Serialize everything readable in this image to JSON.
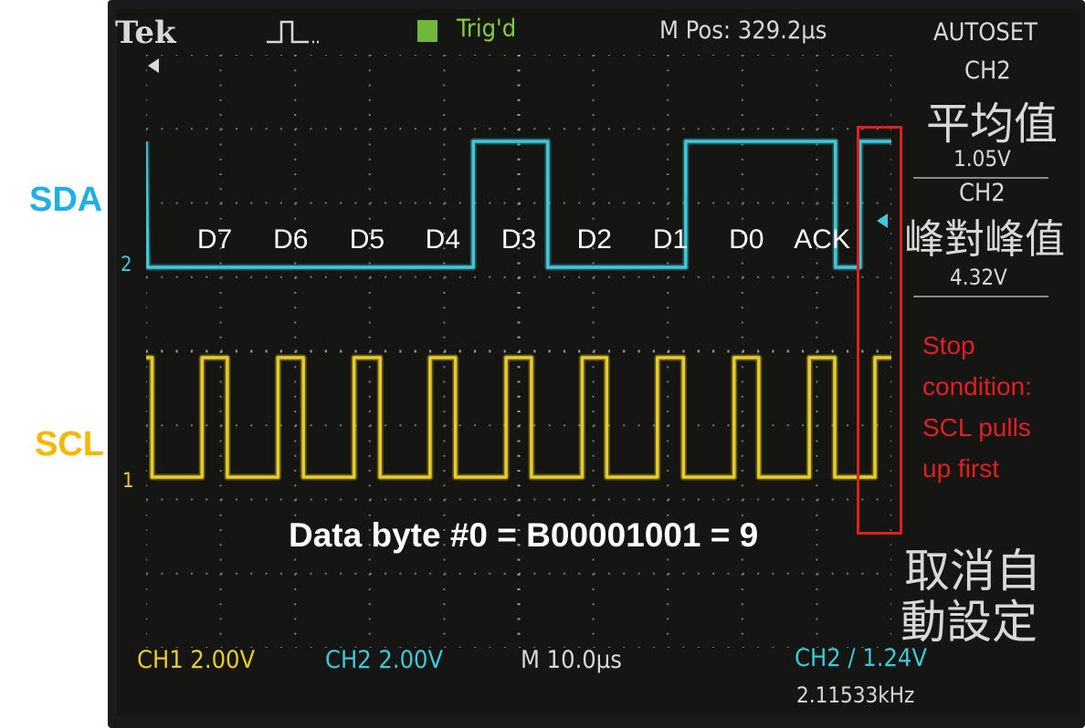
{
  "scope": {
    "brand": "Tek",
    "trigger_status": "Trig'd",
    "mpos": "M Pos: 329.2µs",
    "autoset": "AUTOSET",
    "ch1_scale": "CH1  2.00V",
    "ch2_scale": "CH2  2.00V",
    "timebase": "M 10.0µs",
    "trigger_setting": "CH2 ∕ 1.24V",
    "frequency": "2.11533kHz",
    "ch1_marker": "1",
    "ch2_marker": "2",
    "icons": [
      "run-pulse-icon",
      "trigger-icon",
      "trigger-position-arrow-icon",
      "trigger-level-arrow-icon",
      "rising-edge-icon"
    ]
  },
  "menu": {
    "ch2_a": "CH2",
    "mean_label": "平均值",
    "mean_value": "1.05V",
    "ch2_b": "CH2",
    "pkpk_label": "峰對峰值",
    "pkpk_value": "4.32V",
    "cancel_autoset": "取消自",
    "cancel_autoset_2": "動設定"
  },
  "labels": {
    "sda": "SDA",
    "scl": "SCL",
    "byte_summary": "Data byte #0 = B00001001 = 9",
    "stop_condition": [
      "Stop",
      "condition:",
      "SCL pulls",
      "up first"
    ]
  },
  "chart_data": {
    "type": "line",
    "x_unit": "µs",
    "time_per_div_us": 10,
    "divisions_x": 10,
    "divisions_y": 8,
    "bit_labels": [
      "D7",
      "D6",
      "D5",
      "D4",
      "D3",
      "D2",
      "D1",
      "D0",
      "ACK"
    ],
    "data_byte": {
      "binary": "B00001001",
      "decimal": 9
    },
    "series": [
      {
        "name": "SDA",
        "channel": "CH2",
        "color": "#3ec8d8",
        "volts_per_div": 2.0,
        "points": [
          [
            0,
            1
          ],
          [
            0.2,
            0
          ],
          [
            43.9,
            0
          ],
          [
            43.9,
            1
          ],
          [
            53.9,
            1
          ],
          [
            53.9,
            0
          ],
          [
            72.4,
            0
          ],
          [
            72.4,
            1
          ],
          [
            92.5,
            1
          ],
          [
            92.5,
            0
          ],
          [
            95.8,
            0
          ],
          [
            95.8,
            1
          ],
          [
            100,
            1
          ]
        ]
      },
      {
        "name": "SCL",
        "channel": "CH1",
        "color": "#e8cc28",
        "volts_per_div": 2.0,
        "points": [
          [
            0,
            1
          ],
          [
            0.8,
            1
          ],
          [
            0.8,
            0
          ],
          [
            7.5,
            0
          ],
          [
            7.5,
            1
          ],
          [
            10.9,
            1
          ],
          [
            10.9,
            0
          ],
          [
            17.7,
            0
          ],
          [
            17.7,
            1
          ],
          [
            21.1,
            1
          ],
          [
            21.1,
            0
          ],
          [
            27.9,
            0
          ],
          [
            27.9,
            1
          ],
          [
            31.4,
            1
          ],
          [
            31.4,
            0
          ],
          [
            38.1,
            0
          ],
          [
            38.1,
            1
          ],
          [
            41.5,
            1
          ],
          [
            41.5,
            0
          ],
          [
            48.3,
            0
          ],
          [
            48.3,
            1
          ],
          [
            51.7,
            1
          ],
          [
            51.7,
            0
          ],
          [
            58.5,
            0
          ],
          [
            58.5,
            1
          ],
          [
            61.8,
            1
          ],
          [
            61.8,
            0
          ],
          [
            68.6,
            0
          ],
          [
            68.6,
            1
          ],
          [
            72.1,
            1
          ],
          [
            72.1,
            0
          ],
          [
            78.9,
            0
          ],
          [
            78.9,
            1
          ],
          [
            82.2,
            1
          ],
          [
            82.2,
            0
          ],
          [
            89.0,
            0
          ],
          [
            89.0,
            1
          ],
          [
            92.4,
            1
          ],
          [
            92.4,
            0
          ],
          [
            97.8,
            0
          ],
          [
            97.8,
            1
          ],
          [
            100,
            1
          ]
        ]
      }
    ]
  }
}
